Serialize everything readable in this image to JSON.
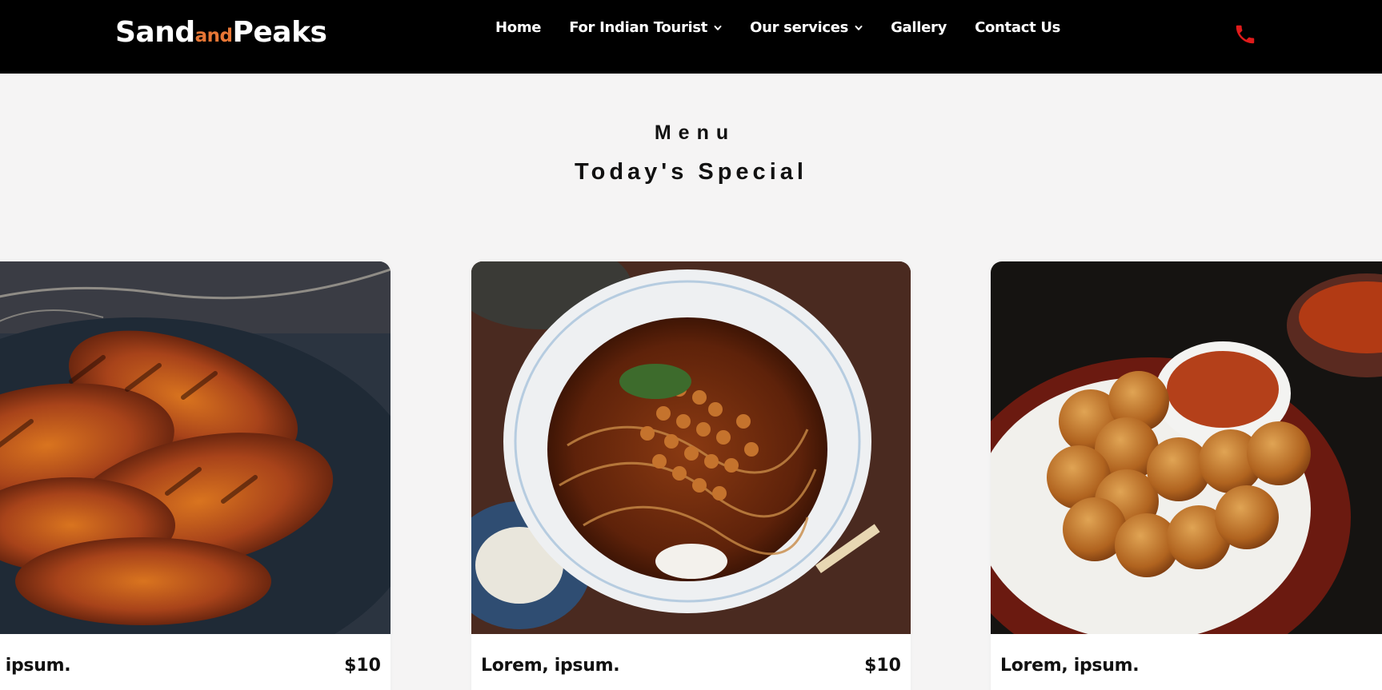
{
  "brand": {
    "part1": "Sand",
    "part2": "and",
    "part3": "Peaks"
  },
  "nav": {
    "items": [
      {
        "label": "Home",
        "dropdown": false
      },
      {
        "label": "For Indian Tourist",
        "dropdown": true
      },
      {
        "label": "Our services",
        "dropdown": true
      },
      {
        "label": "Gallery",
        "dropdown": false
      },
      {
        "label": "Contact Us",
        "dropdown": false
      }
    ],
    "phone_icon": "phone-icon"
  },
  "section": {
    "eyebrow": "Menu",
    "title": "Today's Special"
  },
  "cards": [
    {
      "name": "Lorem, ipsum.",
      "price": "$10",
      "image": "grilled-chicken-photo"
    },
    {
      "name": "Lorem, ipsum.",
      "price": "$10",
      "image": "noodle-soup-photo"
    },
    {
      "name": "Lorem, ipsum.",
      "price": "",
      "image": "pav-bhaji-photo"
    }
  ],
  "colors": {
    "navbar": "#000000",
    "accent": "#e67635",
    "phone": "#e01b1b",
    "page": "#f5f4f4"
  }
}
